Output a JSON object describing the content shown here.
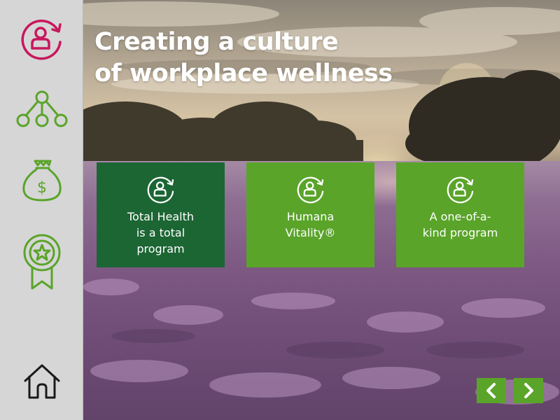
{
  "page": {
    "title_line1": "Creating a culture",
    "title_line2": "of workplace wellness"
  },
  "sidebar": {
    "items": [
      {
        "icon": "person-refresh-icon",
        "color": "#c8175d",
        "active": true
      },
      {
        "icon": "network-hierarchy-icon",
        "color": "#5aa42a",
        "active": false
      },
      {
        "icon": "money-bag-icon",
        "color": "#5aa42a",
        "active": false
      },
      {
        "icon": "award-ribbon-icon",
        "color": "#5aa42a",
        "active": false
      },
      {
        "icon": "home-icon",
        "color": "#1a1a1a",
        "active": false
      }
    ]
  },
  "tiles": [
    {
      "label": "Total Health\nis a total\nprogram",
      "icon": "person-refresh-icon",
      "color": "#1c6634"
    },
    {
      "label": "Humana\nVitality®",
      "icon": "person-refresh-icon",
      "color": "#5aa42a"
    },
    {
      "label": "A one-of-a-\nkind program",
      "icon": "person-refresh-icon",
      "color": "#5aa42a"
    }
  ],
  "navigation": {
    "prev_icon": "chevron-left-icon",
    "next_icon": "chevron-right-icon",
    "button_color": "#5aa42a"
  },
  "colors": {
    "sidebar_bg": "#d6d6d6",
    "accent_magenta": "#c8175d",
    "accent_green": "#5aa42a",
    "dark_green": "#1c6634"
  }
}
